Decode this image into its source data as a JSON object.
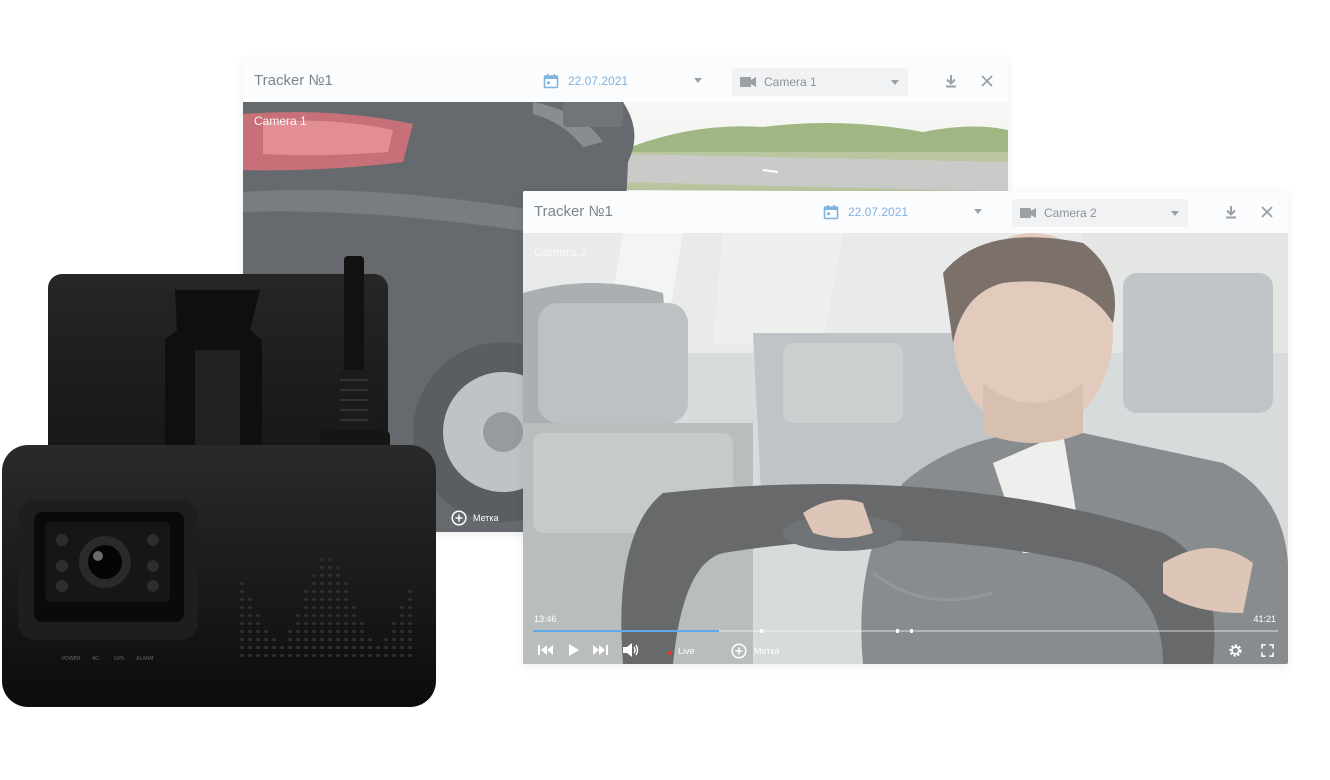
{
  "window1": {
    "title": "Tracker №1",
    "date": "22.07.2021",
    "camera_select": "Camera 1",
    "camera_label": "Camera 1",
    "mark_label": "Метка",
    "icons": {
      "calendar": "calendar-icon",
      "camera": "camera-icon",
      "download": "download-icon",
      "close": "close-icon"
    }
  },
  "window2": {
    "title": "Tracker №1",
    "date": "22.07.2021",
    "camera_select": "Camera 2",
    "camera_label": "Camera 2",
    "time_current": "13:46",
    "time_total": "41:21",
    "progress": 0.25,
    "live_label": "Live",
    "mark_label": "Метка",
    "icons": {
      "skip_back": "skip-back-icon",
      "play": "play-icon",
      "skip_forward": "skip-forward-icon",
      "volume": "volume-icon",
      "add_mark": "add-mark-icon",
      "settings": "gear-icon",
      "fullscreen": "fullscreen-icon"
    }
  },
  "device": {
    "indicators": [
      "POWER",
      "4G",
      "GPS",
      "ALARM"
    ]
  },
  "colors": {
    "accent": "#5ea9e8",
    "date_text": "#7fb3e0",
    "live": "#e53935"
  }
}
